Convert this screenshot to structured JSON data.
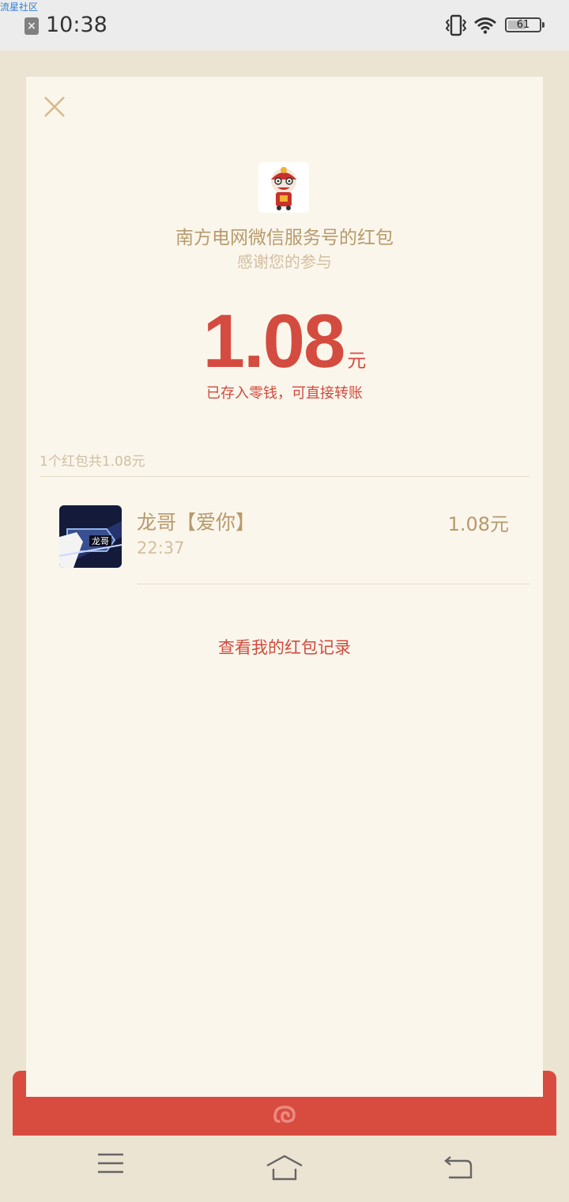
{
  "status_bar": {
    "watermark": "流星社区",
    "time": "10:38",
    "battery": "61",
    "battery_level": 0.61
  },
  "packet": {
    "sender": "南方电网微信服务号的红包",
    "wish": "感谢您的参与",
    "amount": "1.08",
    "unit": "元",
    "stored_note": "已存入零钱，可直接转账"
  },
  "summary": "1个红包共1.08元",
  "receivers": [
    {
      "name": "龙哥【爱你】",
      "time": "22:37",
      "amount": "1.08元",
      "avatar_text": "龙哥"
    }
  ],
  "history_link": "查看我的红包记录",
  "colors": {
    "accent_red": "#d44c3f",
    "gold_text": "#b69a6c",
    "card_bg": "#fbf6ec",
    "page_bg": "#ece4d2"
  },
  "icons": [
    "close-icon",
    "menu-icon",
    "home-icon",
    "back-icon",
    "wifi-icon",
    "vibrate-icon",
    "wechat-pay-logo-icon"
  ]
}
